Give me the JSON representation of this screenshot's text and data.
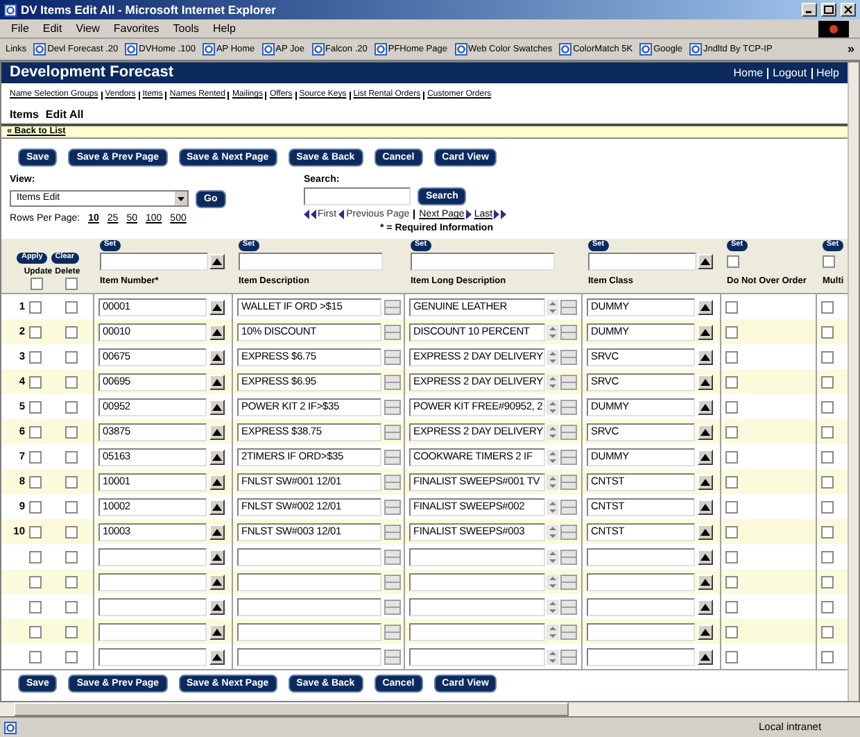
{
  "window": {
    "title": "DV Items Edit All - Microsoft Internet Explorer"
  },
  "menu": [
    "File",
    "Edit",
    "View",
    "Favorites",
    "Tools",
    "Help"
  ],
  "links_bar": {
    "label": "Links",
    "items": [
      "Devl Forecast .20",
      "DVHome .100",
      "AP Home",
      "AP Joe",
      "Falcon .20",
      "PFHome Page",
      "Web Color Swatches",
      "ColorMatch 5K",
      "Google",
      "Jndltd By TCP-IP"
    ],
    "more": "»"
  },
  "header": {
    "title": "Development Forecast",
    "links": [
      "Home",
      "Logout",
      "Help"
    ]
  },
  "nav": [
    "Name Selection Groups",
    "Vendors",
    "Items",
    "Names Rented",
    "Mailings",
    "Offers",
    "Source Keys",
    "List Rental Orders",
    "Customer Orders"
  ],
  "page_title": [
    "Items",
    "Edit All"
  ],
  "back_link": "« Back to List",
  "buttons_top": [
    "Save",
    "Save & Prev Page",
    "Save & Next Page",
    "Save & Back",
    "Cancel",
    "Card View"
  ],
  "view": {
    "label": "View:",
    "value": "Items Edit",
    "go": "Go"
  },
  "rows_per_page": {
    "label": "Rows Per Page:",
    "options": [
      {
        "label": "10",
        "selected": true
      },
      {
        "label": "25",
        "selected": false
      },
      {
        "label": "50",
        "selected": false
      },
      {
        "label": "100",
        "selected": false
      },
      {
        "label": "500",
        "selected": false
      }
    ]
  },
  "search": {
    "label": "Search:",
    "button": "Search"
  },
  "pager": [
    {
      "kind": "first",
      "label": "First",
      "link": false
    },
    {
      "kind": "prev",
      "label": "Previous Page",
      "link": false
    },
    {
      "kind": "next",
      "label": "Next Page",
      "link": true
    },
    {
      "kind": "last",
      "label": "Last",
      "link": true
    }
  ],
  "required_note": "* = Required Information",
  "filter": {
    "apply": "Apply",
    "clear": "Clear",
    "update_label": "Update",
    "delete_label": "Delete",
    "update_all": false,
    "delete_all": false
  },
  "columns": [
    {
      "kind": "lookup",
      "title": "Item Number*",
      "set": "Set"
    },
    {
      "kind": "memo",
      "title": "Item Description",
      "set": "Set"
    },
    {
      "kind": "longmemo",
      "title": "Item Long Description",
      "set": "Set"
    },
    {
      "kind": "lookup",
      "title": "Item Class",
      "set": "Set"
    },
    {
      "kind": "check",
      "title": "Do Not Over Order",
      "set": "Set",
      "checked": false
    },
    {
      "kind": "check",
      "title": "Multi",
      "set": "Set",
      "checked": false
    }
  ],
  "rows": [
    {
      "number": "1",
      "update": false,
      "delete": false,
      "cells": [
        "00001",
        "WALLET IF ORD >$15",
        "GENUINE LEATHER",
        "DUMMY",
        false,
        false
      ]
    },
    {
      "number": "2",
      "update": false,
      "delete": false,
      "cells": [
        "00010",
        "10% DISCOUNT",
        "DISCOUNT 10 PERCENT",
        "DUMMY",
        false,
        false
      ]
    },
    {
      "number": "3",
      "update": false,
      "delete": false,
      "cells": [
        "00675",
        "EXPRESS $6.75",
        "EXPRESS 2 DAY DELIVERY",
        "SRVC",
        false,
        false
      ]
    },
    {
      "number": "4",
      "update": false,
      "delete": false,
      "cells": [
        "00695",
        "EXPRESS $6.95",
        "EXPRESS 2 DAY DELIVERY",
        "SRVC",
        false,
        false
      ]
    },
    {
      "number": "5",
      "update": false,
      "delete": false,
      "cells": [
        "00952",
        "POWER KIT 2 IF>$35",
        "POWER KIT FREE#90952, 2",
        "DUMMY",
        false,
        false
      ]
    },
    {
      "number": "6",
      "update": false,
      "delete": false,
      "cells": [
        "03875",
        "EXPRESS $38.75",
        "EXPRESS 2 DAY DELIVERY",
        "SRVC",
        false,
        false
      ]
    },
    {
      "number": "7",
      "update": false,
      "delete": false,
      "cells": [
        "05163",
        "2TIMERS IF ORD>$35",
        "COOKWARE TIMERS 2 IF",
        "DUMMY",
        false,
        false
      ]
    },
    {
      "number": "8",
      "update": false,
      "delete": false,
      "cells": [
        "10001",
        "FNLST SW#001 12/01",
        "FINALIST SWEEPS#001 TV",
        "CNTST",
        false,
        false
      ]
    },
    {
      "number": "9",
      "update": false,
      "delete": false,
      "cells": [
        "10002",
        "FNLST SW#002 12/01",
        "FINALIST SWEEPS#002",
        "CNTST",
        false,
        false
      ]
    },
    {
      "number": "10",
      "update": false,
      "delete": false,
      "cells": [
        "10003",
        "FNLST SW#003 12/01",
        "FINALIST SWEEPS#003",
        "CNTST",
        false,
        false
      ]
    },
    {
      "update": false,
      "delete": false,
      "cells": [
        null,
        null,
        null,
        null,
        false,
        false
      ]
    },
    {
      "update": false,
      "delete": false,
      "cells": [
        null,
        null,
        null,
        null,
        false,
        false
      ]
    },
    {
      "update": false,
      "delete": false,
      "cells": [
        null,
        null,
        null,
        null,
        false,
        false
      ]
    },
    {
      "update": false,
      "delete": false,
      "cells": [
        null,
        null,
        null,
        null,
        false,
        false
      ]
    },
    {
      "update": false,
      "delete": false,
      "cells": [
        null,
        null,
        null,
        null,
        false,
        false
      ]
    }
  ],
  "buttons_bottom": [
    "Save",
    "Save & Prev Page",
    "Save & Next Page",
    "Save & Back",
    "Cancel",
    "Card View"
  ],
  "status_bar": {
    "zone": "Local intranet"
  }
}
